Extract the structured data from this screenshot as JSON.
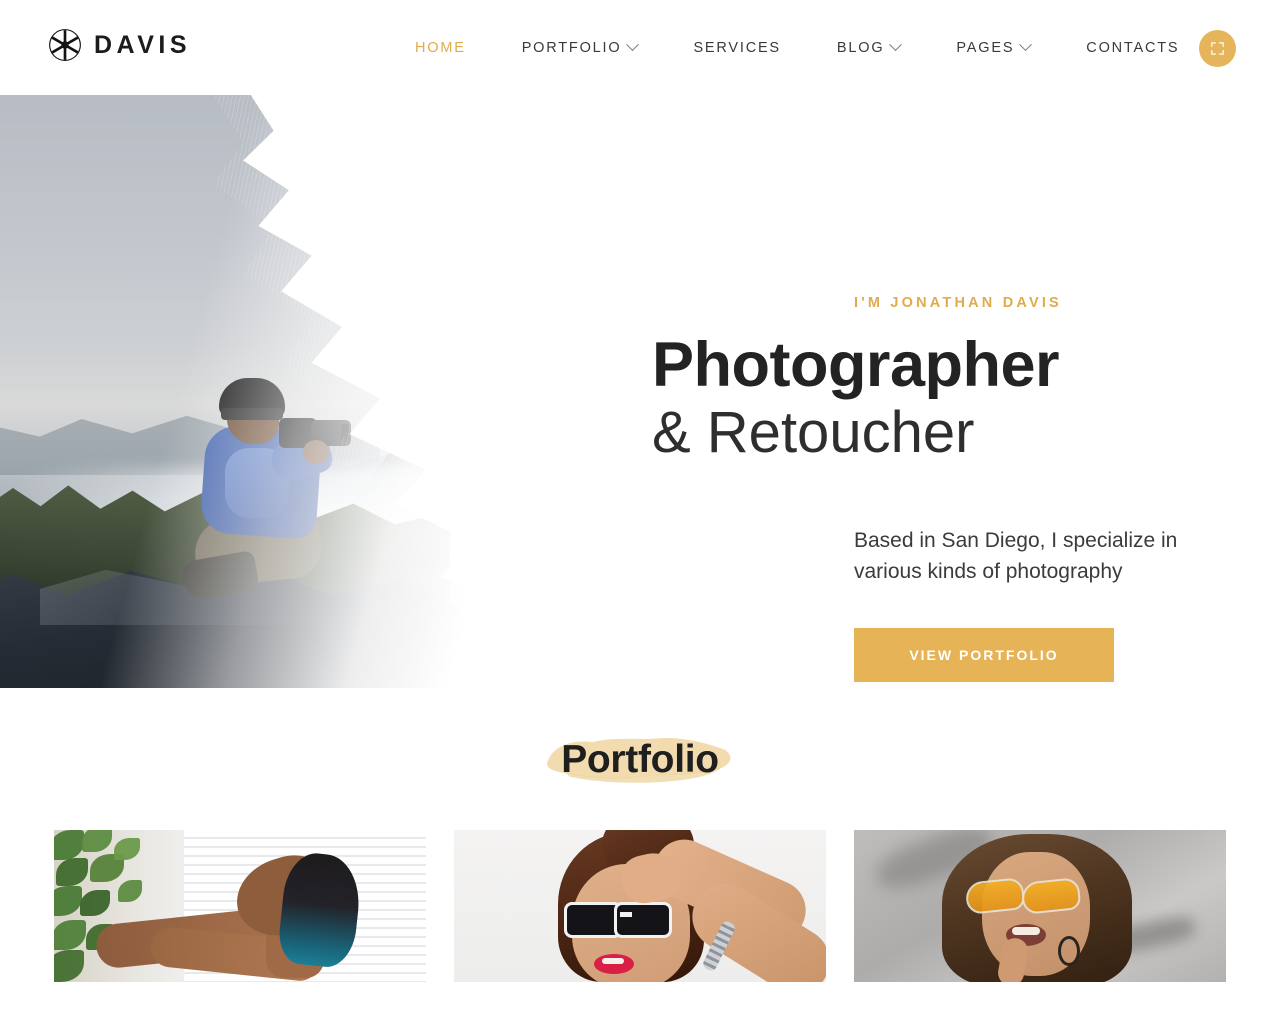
{
  "header": {
    "brand": {
      "text": "DAVIS",
      "icon": "aperture-icon"
    },
    "nav": [
      {
        "label": "HOME",
        "active": true,
        "has_dropdown": false
      },
      {
        "label": "PORTFOLIO",
        "active": false,
        "has_dropdown": true
      },
      {
        "label": "SERVICES",
        "active": false,
        "has_dropdown": false
      },
      {
        "label": "BLOG",
        "active": false,
        "has_dropdown": true
      },
      {
        "label": "PAGES",
        "active": false,
        "has_dropdown": true
      },
      {
        "label": "CONTACTS",
        "active": false,
        "has_dropdown": false
      }
    ],
    "action_button": {
      "icon": "fullscreen-expand-icon",
      "label": ""
    }
  },
  "hero": {
    "eyebrow": "I'M JONATHAN DAVIS",
    "title_bold": "Photographer",
    "title_light": "& Retoucher",
    "subtitle": "Based in San Diego, I specialize in various kinds of photography",
    "cta_label": "VIEW PORTFOLIO",
    "image_alt": "Photographer in blue jacket and black beanie shooting from a mountain summit above clouds"
  },
  "portfolio": {
    "title": "Portfolio",
    "items": [
      {
        "alt": "Woman with teal-tipped hair leaning back beside green foliage and white shutters"
      },
      {
        "alt": "Woman in black sunglasses with red lipstick and hair in a top bun"
      },
      {
        "alt": "Woman in amber aviator sunglasses with hoop earring against grey wall"
      }
    ]
  },
  "colors": {
    "accent": "#e0ab4c",
    "button": "#e6b356",
    "brush": "#f0d8a8",
    "text_dark": "#232323",
    "nav_text": "#3a3a3a"
  }
}
